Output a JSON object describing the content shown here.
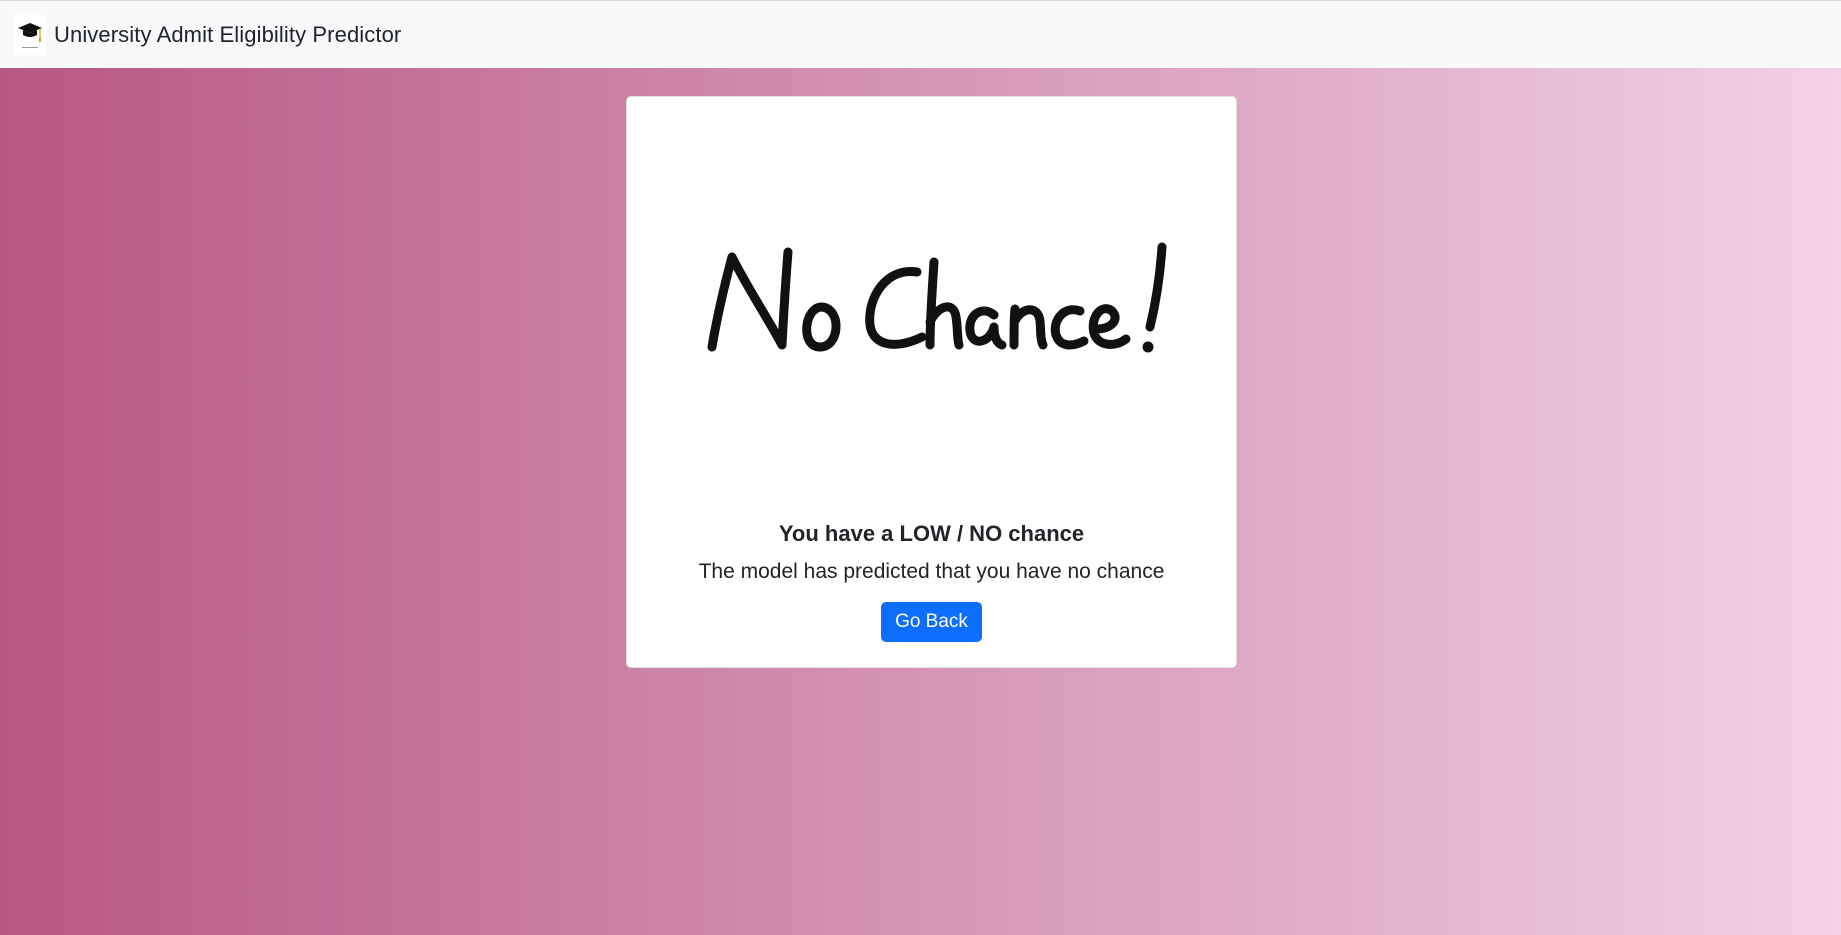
{
  "navbar": {
    "title": "University Admit Eligibility Predictor",
    "logo_icon": "graduation-cap-icon"
  },
  "result_card": {
    "image_text": "No Chance!",
    "title": "You have a LOW / NO chance",
    "message": "The model has predicted that you have no chance",
    "button_label": "Go Back",
    "button_color": "#0d6efd"
  },
  "colors": {
    "gradient_start": "#b95783",
    "gradient_end": "#f2d2e6",
    "navbar_background": "#f8f9fa"
  }
}
